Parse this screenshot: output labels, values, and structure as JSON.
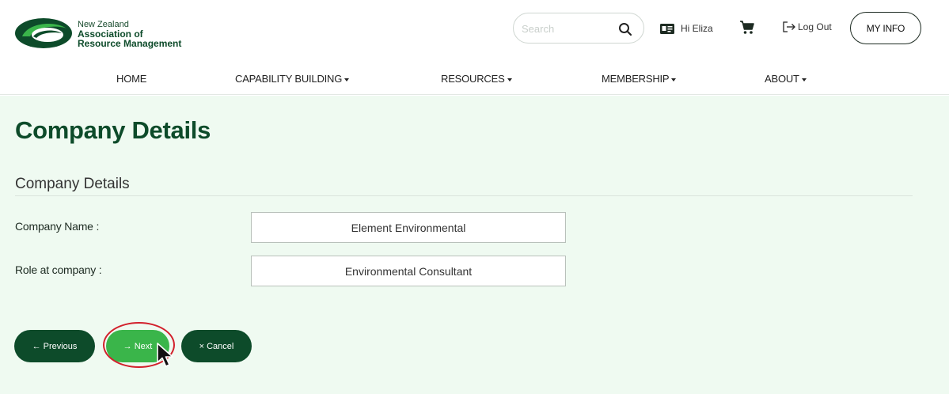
{
  "header": {
    "org_name_line1": "New Zealand",
    "org_name_line2": "Association of",
    "org_name_line3": "Resource Management",
    "search_placeholder": "Search",
    "greeting": "Hi Eliza",
    "logout_label": "Log Out",
    "myinfo_label": "MY INFO"
  },
  "nav": {
    "items": [
      {
        "label": "HOME",
        "dropdown": false
      },
      {
        "label": "CAPABILITY BUILDING",
        "dropdown": true
      },
      {
        "label": "RESOURCES",
        "dropdown": true
      },
      {
        "label": "MEMBERSHIP",
        "dropdown": true
      },
      {
        "label": "ABOUT",
        "dropdown": true
      }
    ]
  },
  "main": {
    "page_title": "Company Details",
    "section_title": "Company Details",
    "fields": [
      {
        "label": "Company Name :",
        "value": "Element Environmental"
      },
      {
        "label": "Role at company :",
        "value": "Environmental Consultant"
      }
    ],
    "buttons": {
      "previous": "← Previous",
      "next": "→ Next",
      "cancel": "× Cancel"
    }
  },
  "colors": {
    "brand_dark": "#0d4b2a",
    "brand_green": "#3ab54a",
    "page_bg": "#effaf1",
    "highlight": "#d21f2b"
  },
  "icons": [
    "logo-swoosh",
    "search-icon",
    "id-card-icon",
    "cart-icon",
    "logout-icon",
    "chevron-down-icon",
    "mouse-pointer-icon"
  ]
}
